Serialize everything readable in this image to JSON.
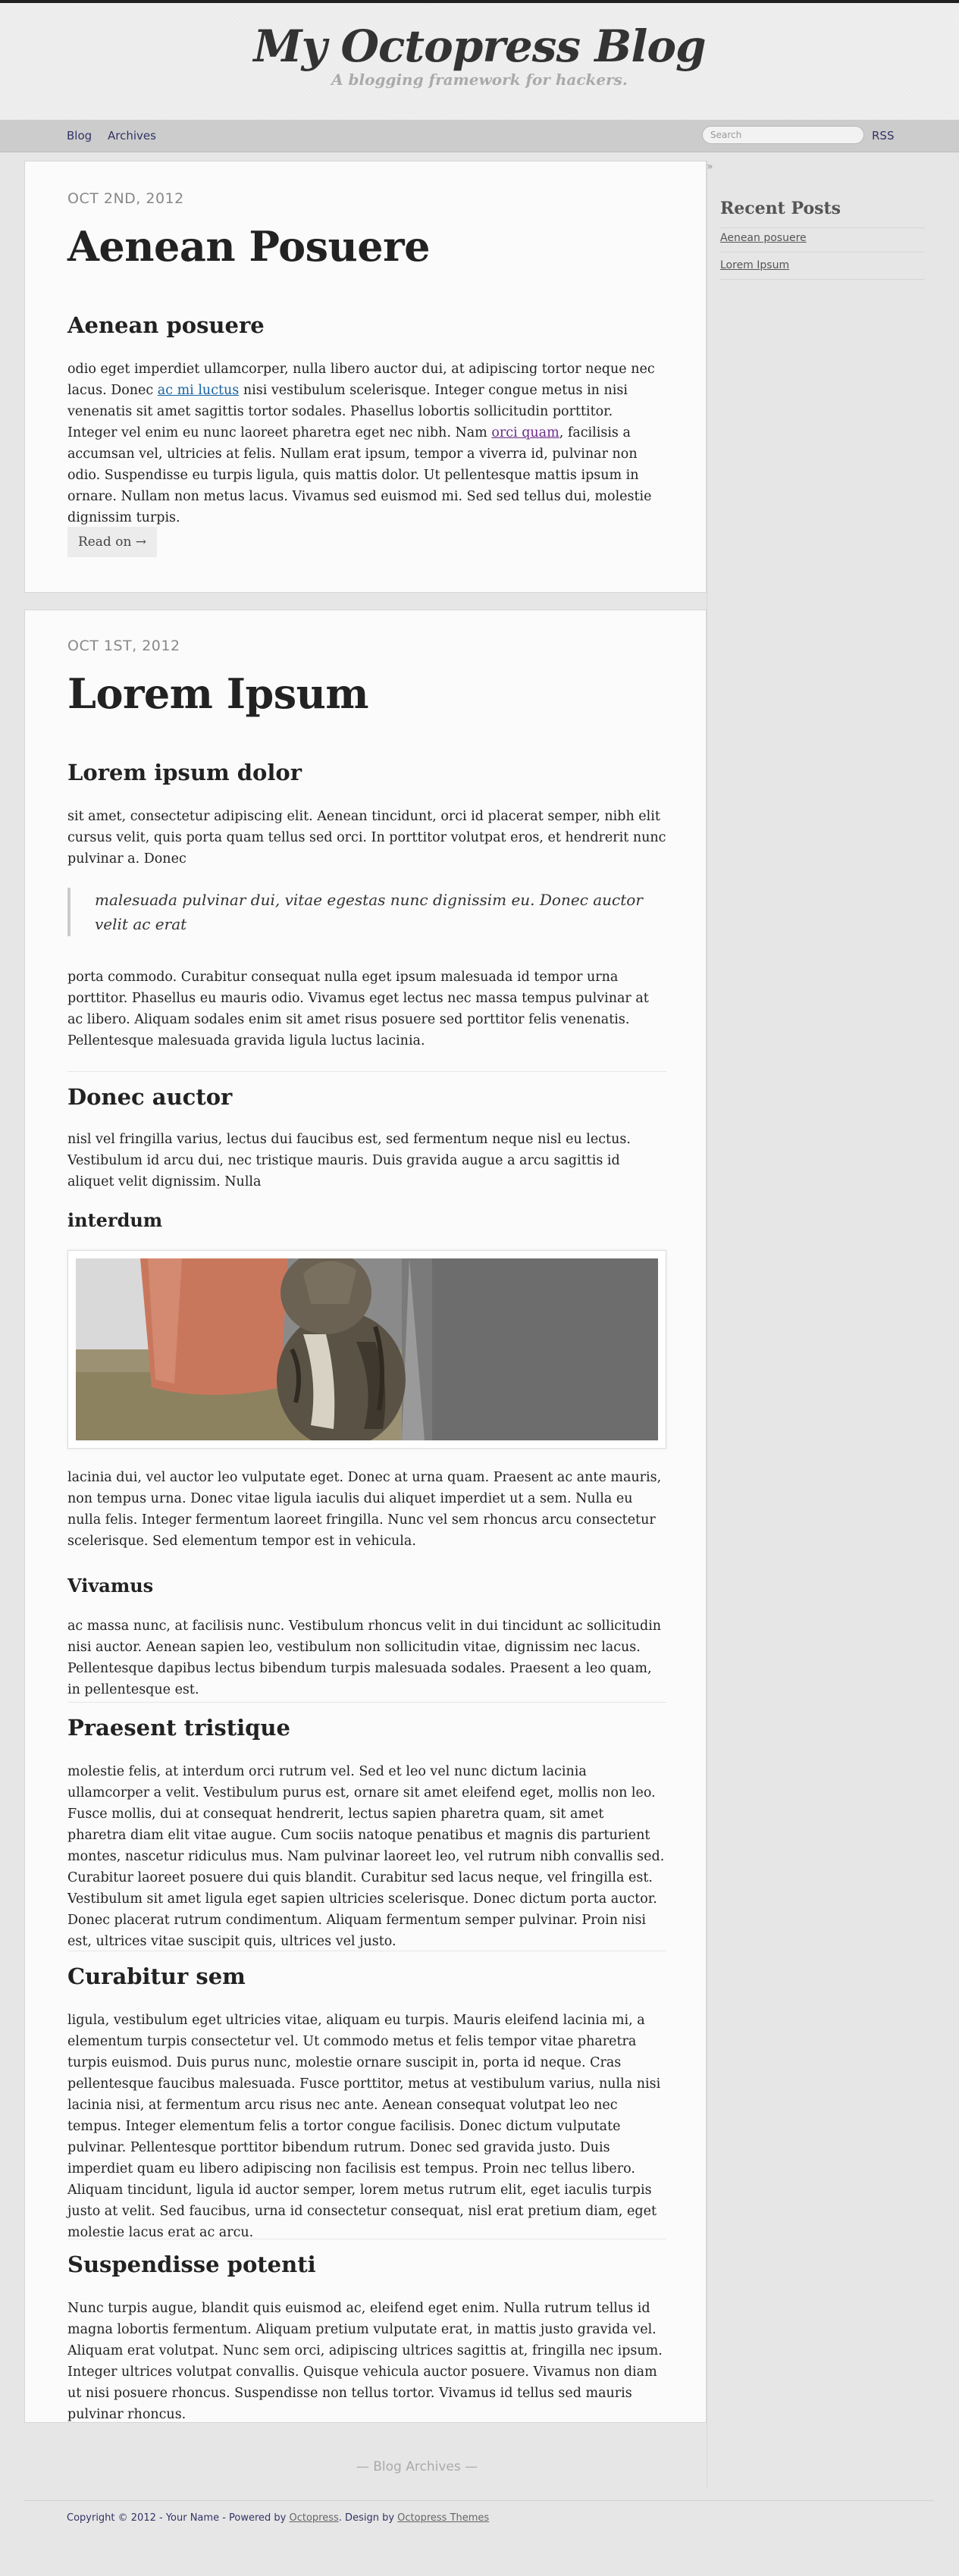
{
  "header": {
    "title": "My Octopress Blog",
    "subtitle": "A blogging framework for hackers."
  },
  "nav": {
    "items": [
      "Blog",
      "Archives"
    ],
    "search_placeholder": "Search",
    "rss": "RSS"
  },
  "sidebar": {
    "toggle": "»",
    "heading": "Recent Posts",
    "posts": [
      "Aenean posuere",
      "Lorem Ipsum"
    ]
  },
  "post1": {
    "date": "OCT 2ND, 2012",
    "title": "Aenean Posuere",
    "h2": "Aenean posuere",
    "p_a": "odio eget imperdiet ullamcorper, nulla libero auctor dui, at adipiscing tortor neque nec lacus. Donec ",
    "link1": "ac mi luctus",
    "p_b": " nisi vestibulum scelerisque. Integer congue metus in nisi venenatis sit amet sagittis tortor sodales. Phasellus lobortis sollicitudin porttitor. Integer vel enim eu nunc laoreet pharetra eget nec nibh. Nam ",
    "link2": "orci quam",
    "p_c": ", facilisis a accumsan vel, ultricies at felis. Nullam erat ipsum, tempor a viverra id, pulvinar non odio. Suspendisse eu turpis ligula, quis mattis dolor. Ut pellentesque mattis ipsum in ornare. Nullam non metus lacus. Vivamus sed euismod mi. Sed sed tellus dui, molestie dignissim turpis.",
    "read_on": "Read on →"
  },
  "post2": {
    "date": "OCT 1ST, 2012",
    "title": "Lorem Ipsum",
    "h_lorem": "Lorem ipsum dolor",
    "p_lorem": "sit amet, consectetur adipiscing elit. Aenean tincidunt, orci id placerat semper, nibh elit cursus velit, quis porta quam tellus sed orci. In porttitor volutpat eros, et hendrerit nunc pulvinar a. Donec",
    "quote": "malesuada pulvinar dui, vitae egestas nunc dignissim eu. Donec auctor velit ac erat",
    "p_porta": "porta commodo. Curabitur consequat nulla eget ipsum malesuada id tempor urna porttitor. Phasellus eu mauris odio. Vivamus eget lectus nec massa tempus pulvinar at ac libero. Aliquam sodales enim sit amet risus posuere sed porttitor felis venenatis. Pellentesque malesuada gravida ligula luctus lacinia.",
    "h_donec": "Donec auctor",
    "p_donec": "nisl vel fringilla varius, lectus dui faucibus est, sed fermentum neque nisl eu lectus. Vestibulum id arcu dui, nec tristique mauris. Duis gravida augue a arcu sagittis id aliquet velit dignissim. Nulla",
    "h_interdum": "interdum",
    "p_lacinia": "lacinia dui, vel auctor leo vulputate eget. Donec at urna quam. Praesent ac ante mauris, non tempus urna. Donec vitae ligula iaculis dui aliquet imperdiet ut a sem. Nulla eu nulla felis. Integer fermentum laoreet fringilla. Nunc vel sem rhoncus arcu consectetur scelerisque. Sed elementum tempor est in vehicula.",
    "h_vivamus": "Vivamus",
    "p_vivamus": "ac massa nunc, at facilisis nunc. Vestibulum rhoncus velit in dui tincidunt ac sollicitudin nisi auctor. Aenean sapien leo, vestibulum non sollicitudin vitae, dignissim nec lacus. Pellentesque dapibus lectus bibendum turpis malesuada sodales. Praesent a leo quam, in pellentesque est.",
    "h_praesent": "Praesent tristique",
    "p_praesent": "molestie felis, at interdum orci rutrum vel. Sed et leo vel nunc dictum lacinia ullamcorper a velit. Vestibulum purus est, ornare sit amet eleifend eget, mollis non leo. Fusce mollis, dui at consequat hendrerit, lectus sapien pharetra quam, sit amet pharetra diam elit vitae augue. Cum sociis natoque penatibus et magnis dis parturient montes, nascetur ridiculus mus. Nam pulvinar laoreet leo, vel rutrum nibh convallis sed. Curabitur laoreet posuere dui quis blandit. Curabitur sed lacus neque, vel fringilla est. Vestibulum sit amet ligula eget sapien ultricies scelerisque. Donec dictum porta auctor. Donec placerat rutrum condimentum. Aliquam fermentum semper pulvinar. Proin nisi est, ultrices vitae suscipit quis, ultrices vel justo.",
    "h_curabitur": "Curabitur sem",
    "p_curabitur": "ligula, vestibulum eget ultricies vitae, aliquam eu turpis. Mauris eleifend lacinia mi, a elementum turpis consectetur vel. Ut commodo metus et felis tempor vitae pharetra turpis euismod. Duis purus nunc, molestie ornare suscipit in, porta id neque. Cras pellentesque faucibus malesuada. Fusce porttitor, metus at vestibulum varius, nulla nisi lacinia nisi, at fermentum arcu risus nec ante. Aenean consequat volutpat leo nec tempus. Integer elementum felis a tortor congue facilisis. Donec dictum vulputate pulvinar. Pellentesque porttitor bibendum rutrum. Donec sed gravida justo. Duis imperdiet quam eu libero adipiscing non facilisis est tempus. Proin nec tellus libero. Aliquam tincidunt, ligula id auctor semper, lorem metus rutrum elit, eget iaculis turpis justo at velit. Sed faucibus, urna id consectetur consequat, nisl erat pretium diam, eget molestie lacus erat ac arcu.",
    "h_suspendisse": "Suspendisse potenti",
    "p_suspendisse": "Nunc turpis augue, blandit quis euismod ac, eleifend eget enim. Nulla rutrum tellus id magna lobortis fermentum. Aliquam pretium vulputate erat, in mattis justo gravida vel. Aliquam erat volutpat. Nunc sem orci, adipiscing ultrices sagittis at, fringilla nec ipsum. Integer ultrices volutpat convallis. Quisque vehicula auctor posuere. Vivamus non diam ut nisi posuere rhoncus. Suspendisse non tellus tortor. Vivamus id tellus sed mauris pulvinar rhoncus."
  },
  "archives_link": "— Blog Archives —",
  "footer": {
    "copyright": "Copyright © 2012 - Your Name - Powered by ",
    "octopress": "Octopress",
    "design_by": ". Design by ",
    "themes": "Octopress Themes"
  }
}
